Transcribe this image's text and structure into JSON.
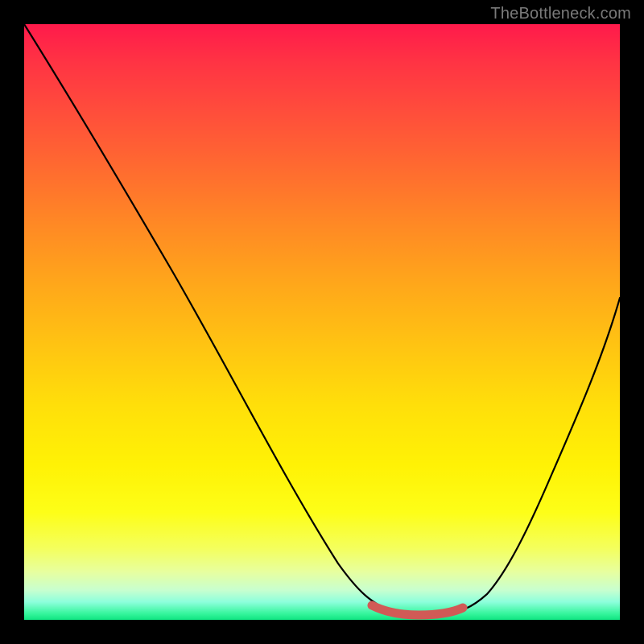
{
  "watermark": "TheBottleneck.com",
  "colors": {
    "frame": "#000000",
    "watermark_text": "#7a7a7a",
    "curve": "#000000",
    "highlight": "#d15a56",
    "gradient_top": "#ff1a4b",
    "gradient_bottom": "#10e481"
  },
  "chart_data": {
    "type": "line",
    "title": "",
    "subtitle": "",
    "xlabel": "",
    "ylabel": "",
    "xlim": [
      0,
      100
    ],
    "ylim": [
      0,
      100
    ],
    "grid": false,
    "legend": false,
    "x": [
      0,
      5,
      10,
      15,
      20,
      25,
      30,
      35,
      40,
      45,
      50,
      55,
      58,
      60,
      63,
      66,
      70,
      73,
      76,
      80,
      84,
      88,
      92,
      96,
      100
    ],
    "values": [
      100,
      92,
      83,
      75,
      66,
      57,
      49,
      40,
      31,
      23,
      15,
      8,
      4,
      2,
      0.5,
      0,
      0,
      0.5,
      2,
      6,
      13,
      22,
      32,
      43,
      55
    ],
    "annotations": [
      {
        "kind": "highlight-segment",
        "x_range": [
          58,
          73
        ],
        "y": 0,
        "note": "bottom plateau"
      }
    ]
  }
}
